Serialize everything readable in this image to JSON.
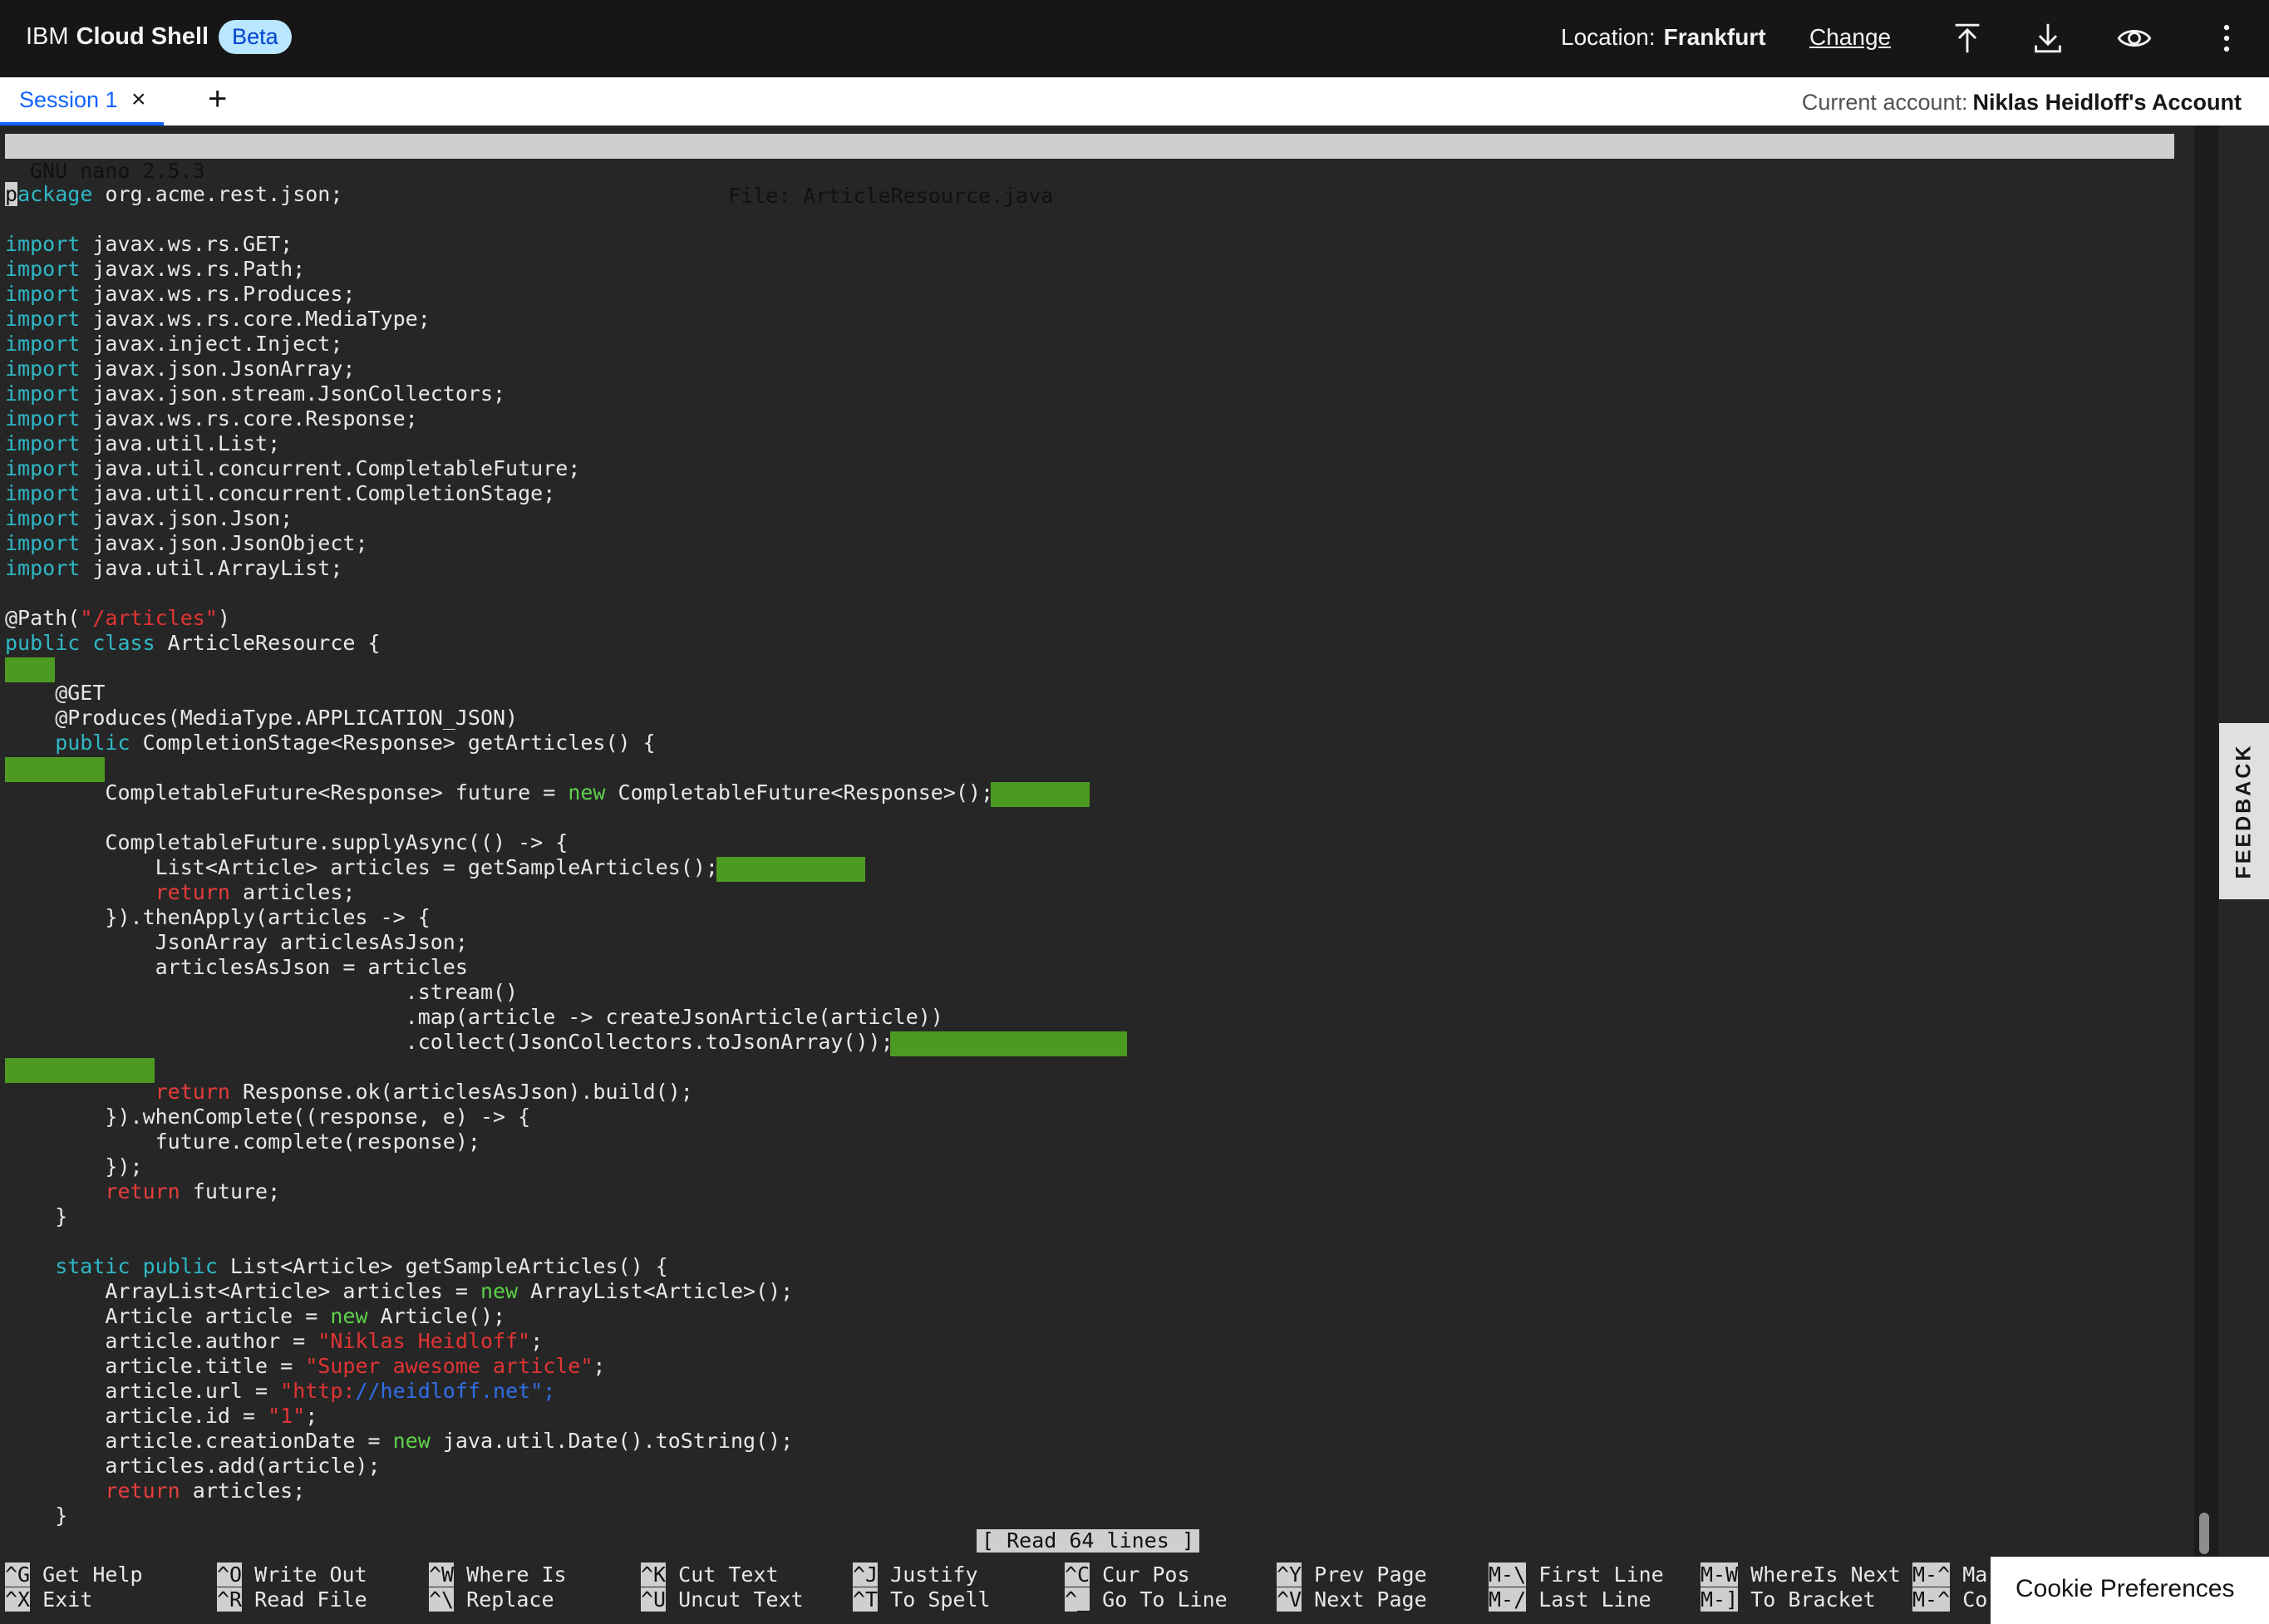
{
  "header": {
    "brand_prefix": "IBM",
    "brand_name": "Cloud Shell",
    "badge": "Beta",
    "location_label": "Location:",
    "location_value": "Frankfurt",
    "change_link": "Change",
    "icons": [
      "upload-icon",
      "download-icon",
      "view-icon",
      "overflow-menu-icon"
    ]
  },
  "tabs": {
    "items": [
      {
        "label": "Session 1",
        "close": "×"
      }
    ],
    "add": "+",
    "account_label": "Current account:",
    "account_value": "Niklas Heidloff's Account"
  },
  "editor": {
    "version": "GNU nano 2.5.3",
    "file_title": "File: ArticleResource.java",
    "status": "[ Read 64 lines ]"
  },
  "code": {
    "l_package": "ackage org.acme.rest.json;",
    "imports": [
      " javax.ws.rs.GET;",
      " javax.ws.rs.Path;",
      " javax.ws.rs.Produces;",
      " javax.ws.rs.core.MediaType;",
      " javax.inject.Inject;",
      " javax.json.JsonArray;",
      " javax.json.stream.JsonCollectors;",
      " javax.ws.rs.core.Response;",
      " java.util.List;",
      " java.util.concurrent.CompletableFuture;",
      " java.util.concurrent.CompletionStage;",
      " javax.json.Json;",
      " javax.json.JsonObject;",
      " java.util.ArrayList;"
    ],
    "l_path_a": "@Path(",
    "l_path_str": "\"/articles\"",
    "l_path_b": ")",
    "l_class_a": "public class",
    "l_class_b": " ArticleResource {",
    "l_get": "    @GET",
    "l_produces": "    @Produces(MediaType.APPLICATION_JSON)",
    "l_method_a": "    public",
    "l_method_b": " CompletionStage<Response> getArticles() {",
    "l_future_a": "        CompletableFuture<Response> future = ",
    "l_future_new": "new",
    "l_future_b": " CompletableFuture<Response>();",
    "l_supply": "        CompletableFuture.supplyAsync(() -> {",
    "l_list": "            List<Article> articles = getSampleArticles();",
    "l_ret1_a": "            ",
    "l_ret1_b": " articles;",
    "l_then": "        }).thenApply(articles -> {",
    "l_jsonarr": "            JsonArray articlesAsJson;",
    "l_assign": "            articlesAsJson = articles",
    "l_stream": "                                .stream()",
    "l_map": "                                .map(article -> createJsonArticle(article))",
    "l_collect": "                                .collect(JsonCollectors.toJsonArray());",
    "l_ret2_a": "            ",
    "l_ret2_b": " Response.ok(articlesAsJson).build();",
    "l_when": "        }).whenComplete((response, e) -> {",
    "l_complete": "            future.complete(response);",
    "l_close1": "        });",
    "l_ret3_a": "        ",
    "l_ret3_b": " future;",
    "l_brace1": "    }",
    "l_static_a": "    static public",
    "l_static_b": " List<Article> getSampleArticles() {",
    "l_alist_a": "        ArrayList<Article> articles = ",
    "l_alist_b": " ArrayList<Article>();",
    "l_art_a": "        Article article = ",
    "l_art_b": " Article();",
    "l_author_a": "        article.author = ",
    "l_author_str": "\"Niklas Heidloff\"",
    "l_title_a": "        article.title = ",
    "l_title_str": "\"Super awesome article\"",
    "l_url_a": "        article.url = ",
    "l_url_str1": "\"http:",
    "l_url_str2": "//heidloff.net\";",
    "l_id_a": "        article.id = ",
    "l_id_str": "\"1\"",
    "l_cdate_a": "        article.creationDate = ",
    "l_cdate_b": " java.util.Date().toString();",
    "l_add": "        articles.add(article);",
    "l_ret4_a": "        ",
    "l_ret4_b": " articles;",
    "l_brace2": "    }",
    "kw_import": "import",
    "kw_new": "new",
    "kw_return": "return",
    "semi": ";",
    "cursor_char": "p"
  },
  "shortcuts": [
    {
      "k1": "^G",
      "l1": "Get Help",
      "k2": "^X",
      "l2": "Exit"
    },
    {
      "k1": "^O",
      "l1": "Write Out",
      "k2": "^R",
      "l2": "Read File"
    },
    {
      "k1": "^W",
      "l1": "Where Is",
      "k2": "^\\",
      "l2": "Replace"
    },
    {
      "k1": "^K",
      "l1": "Cut Text",
      "k2": "^U",
      "l2": "Uncut Text"
    },
    {
      "k1": "^J",
      "l1": "Justify",
      "k2": "^T",
      "l2": "To Spell"
    },
    {
      "k1": "^C",
      "l1": "Cur Pos",
      "k2": "^_",
      "l2": "Go To Line"
    },
    {
      "k1": "^Y",
      "l1": "Prev Page",
      "k2": "^V",
      "l2": "Next Page"
    },
    {
      "k1": "M-\\",
      "l1": "First Line",
      "k2": "M-/",
      "l2": "Last Line"
    },
    {
      "k1": "M-W",
      "l1": "WhereIs Next",
      "k2": "M-]",
      "l2": "To Bracket"
    },
    {
      "k1": "M-^",
      "l1": "Mar",
      "k2": "M-^",
      "l2": "Co"
    }
  ],
  "feedback": "FEEDBACK",
  "cookie": "Cookie Preferences",
  "colors": {
    "header_bg": "#161616",
    "badge_bg": "#bae6ff",
    "tab_accent": "#0f62fe",
    "terminal_bg": "#262626",
    "keyword": "#2fb8c6",
    "keyword_green": "#5ed04a",
    "keyword_red": "#e63d3d",
    "whitespace_highlight": "#4d9a22"
  }
}
